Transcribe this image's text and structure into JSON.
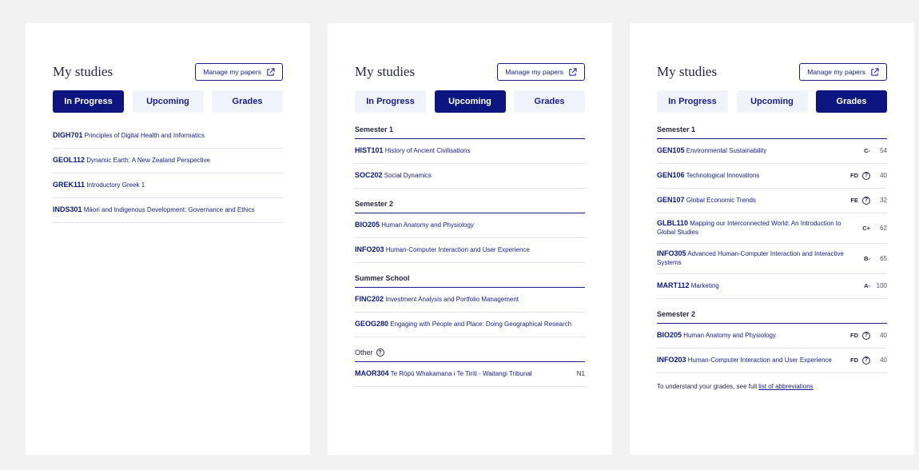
{
  "common": {
    "title": "My studies",
    "manage_label": "Manage my papers",
    "tabs": [
      "In Progress",
      "Upcoming",
      "Grades"
    ]
  },
  "card1": {
    "active_tab": "In Progress",
    "papers": [
      {
        "code": "DIGH701",
        "name": "Principles of Digital Health and Informatics"
      },
      {
        "code": "GEOL112",
        "name": "Dynamic Earth: A New Zealand Perspective"
      },
      {
        "code": "GREK111",
        "name": "Introductory Greek 1"
      },
      {
        "code": "INDS301",
        "name": "Māori and Indigenous Development: Governance and Ethics"
      }
    ]
  },
  "card2": {
    "active_tab": "Upcoming",
    "semester1": {
      "label": "Semester 1",
      "papers": [
        {
          "code": "HIST101",
          "name": "History of Ancient Civilisations"
        },
        {
          "code": "SOC202",
          "name": "Social Dynamics"
        }
      ]
    },
    "semester2": {
      "label": "Semester 2",
      "papers": [
        {
          "code": "BIO205",
          "name": "Human Anatomy and Physiology"
        },
        {
          "code": "INFO203",
          "name": "Human-Computer Interaction and User Experience"
        }
      ]
    },
    "summer": {
      "label": "Summer School",
      "papers": [
        {
          "code": "FINC202",
          "name": "Investment Analysis and Portfolio Management"
        },
        {
          "code": "GEOG280",
          "name": "Engaging with People and Place: Doing Geographical Research"
        }
      ]
    },
    "other": {
      "label": "Other",
      "papers": [
        {
          "code": "MAOR304",
          "name": "Te Rōpū Whakamana i Te Tiriti - Waitangi Tribunal",
          "badge": "N1"
        }
      ]
    }
  },
  "card3": {
    "active_tab": "Grades",
    "semester1": {
      "label": "Semester 1",
      "papers": [
        {
          "code": "GEN105",
          "name": "Environmental Sustainability",
          "grade": "C-",
          "mark": "54"
        },
        {
          "code": "GEN106",
          "name": "Technological Innovations",
          "grade": "FD",
          "mark": "40"
        },
        {
          "code": "GEN107",
          "name": "Global Economic Trends",
          "grade": "FE",
          "mark": "32"
        },
        {
          "code": "GLBL110",
          "name": "Mapping our Interconnected World: An Introduction to Global Studies",
          "grade": "C+",
          "mark": "62"
        },
        {
          "code": "INFO305",
          "name": "Advanced Human-Computer Interaction and Interactive Systems",
          "grade": "B-",
          "mark": "65"
        },
        {
          "code": "MART112",
          "name": "Marketing",
          "grade": "A-",
          "mark": "100"
        }
      ]
    },
    "semester2": {
      "label": "Semester 2",
      "papers": [
        {
          "code": "BIO205",
          "name": "Human Anatomy and Physiology",
          "grade": "FD",
          "mark": "40"
        },
        {
          "code": "INFO203",
          "name": "Human-Computer Interaction and User Experience",
          "grade": "FD",
          "mark": "40"
        }
      ]
    },
    "note_text": "To understand your grades, see full",
    "note_link": "list of abbreviations"
  },
  "colors": {
    "brand_navy": "#0d1680",
    "link_blue": "#1a1a8c",
    "tab_inactive_bg": "#f0f4fa",
    "page_bg": "#f2f2f2"
  },
  "icons": {
    "manage": "external-link-icon",
    "help": "question-circle-icon"
  }
}
